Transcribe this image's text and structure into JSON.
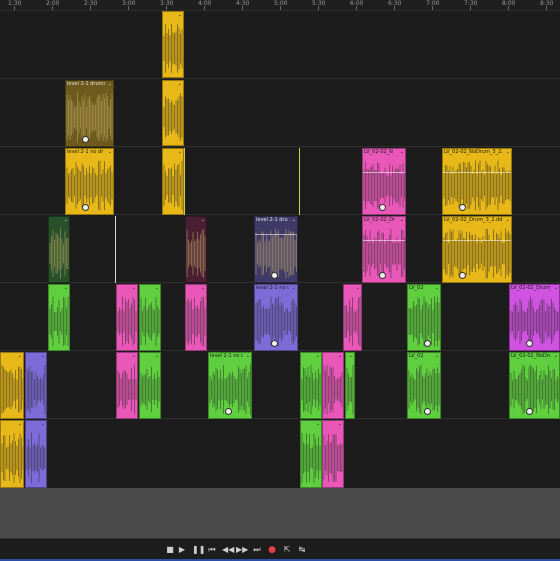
{
  "ruler": {
    "ticks": [
      "1:30",
      "2:00",
      "2:30",
      "3:00",
      "3:30",
      "4:00",
      "4:30",
      "5:00",
      "5:30",
      "6:00",
      "6:30",
      "7:00",
      "7:30",
      "8:00",
      "8:30"
    ]
  },
  "colors": {
    "yellow": "#e7b817",
    "green": "#5fcf3f",
    "pink": "#e957b8",
    "purple": "#7d6bd8",
    "magenta": "#cf52e0",
    "darkyellow": "#6e5a1d",
    "darkpurple": "#403a68",
    "darkred": "#4a1f33",
    "darkgreen": "#28502a"
  },
  "clips": [
    {
      "title": "",
      "fx": "",
      "color": "yellow"
    },
    {
      "title": "",
      "fx": "",
      "color": "yellow"
    },
    {
      "title": "level 2-1 drums",
      "fx": "",
      "color": "darkyellow"
    },
    {
      "title": "",
      "fx": "",
      "color": "yellow"
    },
    {
      "title": "level 2-1 no dr",
      "fx": "",
      "color": "yellow"
    },
    {
      "title": "LV_02-02_N",
      "fx": "",
      "color": "pink"
    },
    {
      "title": "LV_02-02_NoDrum_3_2.d",
      "fx": "",
      "color": "yellow"
    },
    {
      "title": "",
      "fx": "",
      "color": "darkgreen"
    },
    {
      "title": "",
      "fx": "",
      "color": "darkred"
    },
    {
      "title": "level 2-1 dru",
      "fx": "",
      "color": "darkpurple"
    },
    {
      "title": "LV_02-02_Dr",
      "fx": "",
      "color": "pink"
    },
    {
      "title": "LV_02-02_Drum_3_2.dd",
      "fx": "",
      "color": "yellow"
    },
    {
      "title": "",
      "fx": "",
      "color": "green"
    },
    {
      "title": "",
      "fx": "",
      "color": "pink"
    },
    {
      "title": "",
      "fx": "",
      "color": "green"
    },
    {
      "title": "",
      "fx": "",
      "color": "pink"
    },
    {
      "title": "level 2-1 no d",
      "fx": "",
      "color": "purple"
    },
    {
      "title": "",
      "fx": "",
      "color": "pink"
    },
    {
      "title": "LV_02",
      "fx": "",
      "color": "green"
    },
    {
      "title": "LV_02-02_Drum_4_sop",
      "fx": "",
      "color": "magenta"
    },
    {
      "title": "",
      "fx": "",
      "color": "yellow"
    },
    {
      "title": "",
      "fx": "",
      "color": "purple"
    },
    {
      "title": "",
      "fx": "",
      "color": "pink"
    },
    {
      "title": "",
      "fx": "",
      "color": "green"
    },
    {
      "title": "level 2-1 no d",
      "fx": "",
      "color": "green"
    },
    {
      "title": "",
      "fx": "",
      "color": "green"
    },
    {
      "title": "",
      "fx": "",
      "color": "pink"
    },
    {
      "title": "",
      "fx": "",
      "color": "green"
    },
    {
      "title": "LV_02",
      "fx": "",
      "color": "green"
    },
    {
      "title": "LV_02-02_NoDrum_4",
      "fx": "",
      "color": "green"
    },
    {
      "title": "",
      "fx": "",
      "color": "yellow"
    },
    {
      "title": "",
      "fx": "",
      "color": "purple"
    },
    {
      "title": "",
      "fx": "",
      "color": "green"
    },
    {
      "title": "",
      "fx": "",
      "color": "pink"
    }
  ],
  "transport": {
    "buttons": [
      {
        "name": "stop-button",
        "glyph": "■"
      },
      {
        "name": "play-button",
        "glyph": "▶"
      },
      {
        "name": "pause-button",
        "glyph": "❚❚"
      },
      {
        "name": "go-to-start-button",
        "glyph": "⏮"
      },
      {
        "name": "rewind-button",
        "glyph": "◀◀"
      },
      {
        "name": "fast-forward-button",
        "glyph": "▶▶"
      },
      {
        "name": "go-to-end-button",
        "glyph": "⏭"
      },
      {
        "name": "record-button",
        "glyph": "●"
      },
      {
        "name": "export-button",
        "glyph": "⇱"
      },
      {
        "name": "skip-selected-button",
        "glyph": "↹"
      }
    ]
  }
}
